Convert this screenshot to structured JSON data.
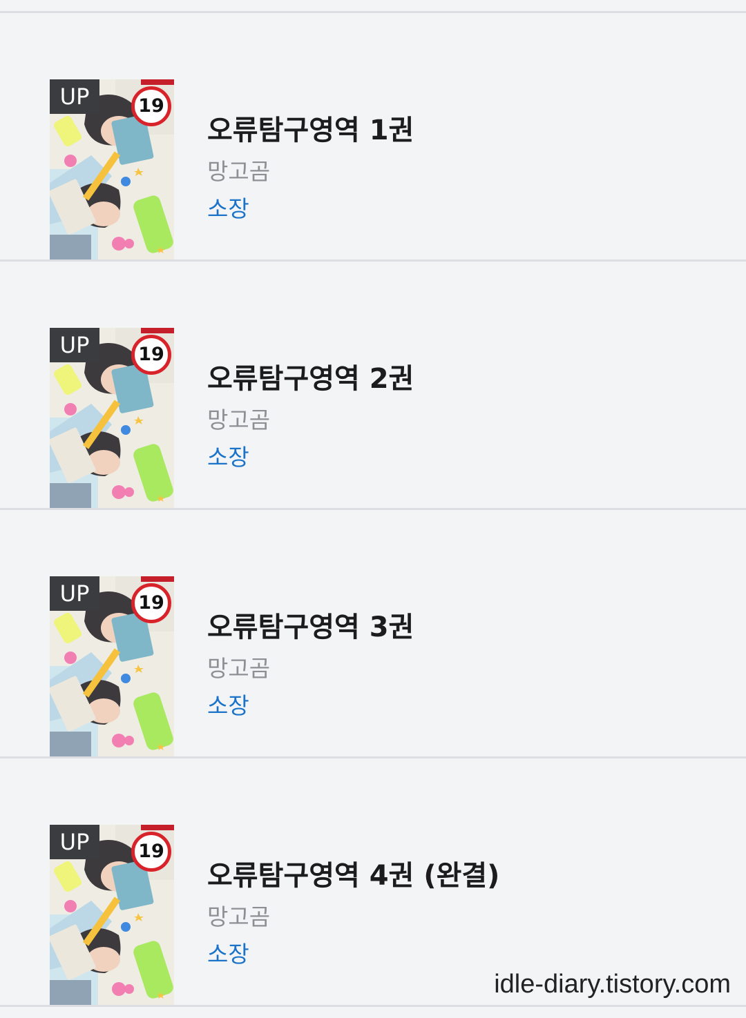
{
  "books": [
    {
      "title": "오류탐구영역 1권",
      "author": "망고곰",
      "status": "소장",
      "badge": "UP",
      "age_rating": "19"
    },
    {
      "title": "오류탐구영역 2권",
      "author": "망고곰",
      "status": "소장",
      "badge": "UP",
      "age_rating": "19"
    },
    {
      "title": "오류탐구영역 3권",
      "author": "망고곰",
      "status": "소장",
      "badge": "UP",
      "age_rating": "19"
    },
    {
      "title": "오류탐구영역 4권 (완결)",
      "author": "망고곰",
      "status": "소장",
      "badge": "UP",
      "age_rating": "19"
    }
  ],
  "watermark": "idle-diary.tistory.com",
  "colors": {
    "background": "#f3f4f6",
    "divider": "#dcdee2",
    "title": "#1c1c1e",
    "author": "#8d8f94",
    "status": "#1a73c9",
    "age_badge_ring": "#d8232a",
    "up_badge": "#3b3c3f"
  }
}
